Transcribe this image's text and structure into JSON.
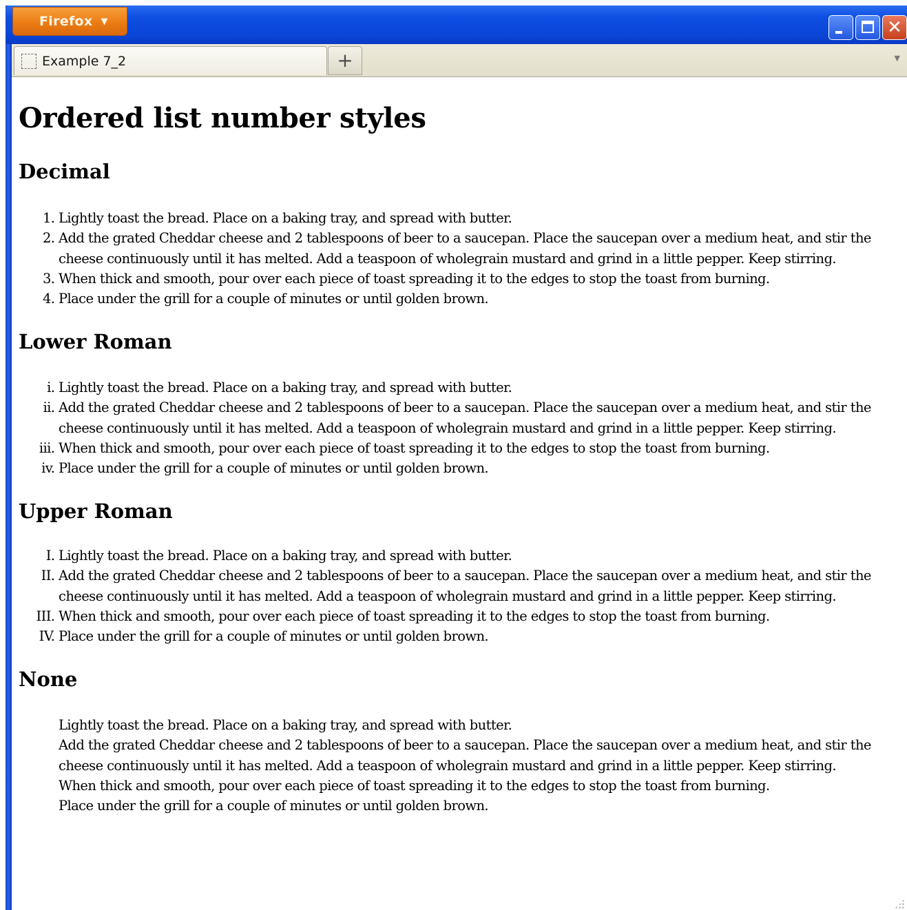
{
  "browser": {
    "menu_button_label": "Firefox",
    "menu_caret": "▼",
    "tab_title": "Example 7_2",
    "new_tab_label": "+",
    "tab_list_caret": "▼",
    "close_glyph": "✕"
  },
  "page": {
    "title": "Ordered list number styles",
    "sections": [
      {
        "heading": "Decimal",
        "list_style": "decimal",
        "items": [
          "Lightly toast the bread. Place on a baking tray, and spread with butter.",
          "Add the grated Cheddar cheese and 2 tablespoons of beer to a saucepan. Place the saucepan over a medium heat, and stir the cheese continuously until it has melted. Add a teaspoon of wholegrain mustard and grind in a little pepper. Keep stirring.",
          "When thick and smooth, pour over each piece of toast spreading it to the edges to stop the toast from burning.",
          "Place under the grill for a couple of minutes or until golden brown."
        ]
      },
      {
        "heading": "Lower Roman",
        "list_style": "lower-roman",
        "items": [
          "Lightly toast the bread. Place on a baking tray, and spread with butter.",
          "Add the grated Cheddar cheese and 2 tablespoons of beer to a saucepan. Place the saucepan over a medium heat, and stir the cheese continuously until it has melted. Add a teaspoon of wholegrain mustard and grind in a little pepper. Keep stirring.",
          "When thick and smooth, pour over each piece of toast spreading it to the edges to stop the toast from burning.",
          "Place under the grill for a couple of minutes or until golden brown."
        ]
      },
      {
        "heading": "Upper Roman",
        "list_style": "upper-roman",
        "items": [
          "Lightly toast the bread. Place on a baking tray, and spread with butter.",
          "Add the grated Cheddar cheese and 2 tablespoons of beer to a saucepan. Place the saucepan over a medium heat, and stir the cheese continuously until it has melted. Add a teaspoon of wholegrain mustard and grind in a little pepper. Keep stirring.",
          "When thick and smooth, pour over each piece of toast spreading it to the edges to stop the toast from burning.",
          "Place under the grill for a couple of minutes or until golden brown."
        ]
      },
      {
        "heading": "None",
        "list_style": "none",
        "items": [
          "Lightly toast the bread. Place on a baking tray, and spread with butter.",
          "Add the grated Cheddar cheese and 2 tablespoons of beer to a saucepan. Place the saucepan over a medium heat, and stir the cheese continuously until it has melted. Add a teaspoon of wholegrain mustard and grind in a little pepper. Keep stirring.",
          "When thick and smooth, pour over each piece of toast spreading it to the edges to stop the toast from burning.",
          "Place under the grill for a couple of minutes or until golden brown."
        ]
      }
    ]
  },
  "colors": {
    "titlebar": "#0a46d8",
    "firefox_button": "#ec7c14",
    "close_button": "#c8401c",
    "tabstrip": "#ece9d8"
  }
}
